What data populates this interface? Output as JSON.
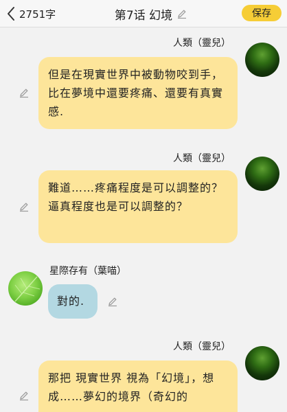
{
  "header": {
    "word_count": "2751字",
    "title": "第7话 幻境",
    "save_label": "保存"
  },
  "messages": [
    {
      "speaker": "人類（靈兒）",
      "text": "但是在現實世界中被動物咬到手，比在夢境中還要疼痛、還要有真實感."
    },
    {
      "speaker": "人類（靈兒）",
      "text": "難道……疼痛程度是可以調整的？逼真程度也是可以調整的？"
    },
    {
      "speaker": "星際存有（葉喵）",
      "text": "對的."
    },
    {
      "speaker": "人類（靈兒）",
      "text": "那把 現實世界 視為「幻境」，想成……夢幻的境界（奇幻的"
    }
  ],
  "colors": {
    "accent": "#f6cd36",
    "bubble_yellow": "#fde59a",
    "bubble_blue": "#b3d8e2",
    "background": "#f2f2f2"
  }
}
